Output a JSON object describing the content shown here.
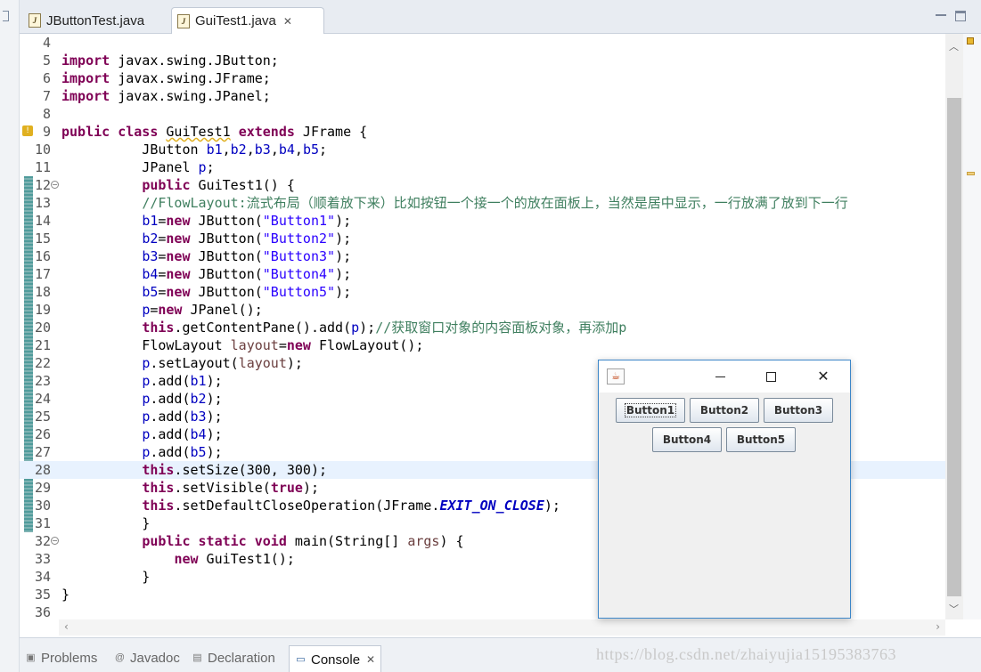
{
  "editor": {
    "tabs": [
      {
        "label": "JButtonTest.java",
        "active": false
      },
      {
        "label": "GuiTest1.java",
        "active": true
      }
    ],
    "lines": [
      {
        "num": "4",
        "html": ""
      },
      {
        "num": "5",
        "html": "<b style='color:#7f0055'>import</b> javax.swing.JButton;"
      },
      {
        "num": "6",
        "html": "<b style='color:#7f0055'>import</b> javax.swing.JFrame;"
      },
      {
        "num": "7",
        "html": "<b style='color:#7f0055'>import</b> javax.swing.JPanel;"
      },
      {
        "num": "8",
        "html": ""
      },
      {
        "num": "9",
        "html": "<b style='color:#7f0055'>public</b> <b style='color:#7f0055'>class</b> <span style='text-decoration:underline wavy #e0b020'>GuiTest1</span> <b style='color:#7f0055'>extends</b> JFrame {"
      },
      {
        "num": "10",
        "html": "          JButton <span style='color:#0000c0'>b1</span>,<span style='color:#0000c0'>b2</span>,<span style='color:#0000c0'>b3</span>,<span style='color:#0000c0'>b4</span>,<span style='color:#0000c0'>b5</span>;"
      },
      {
        "num": "11",
        "html": "          JPanel <span style='color:#0000c0'>p</span>;"
      },
      {
        "num": "12",
        "html": "          <b style='color:#7f0055'>public</b> GuiTest1() {",
        "fold": true
      },
      {
        "num": "13",
        "html": "          <span style='color:#3f7f5f'>//FlowLayout:流式布局（顺着放下来）比如按钮一个接一个的放在面板上，当然是居中显示，一行放满了放到下一行</span>"
      },
      {
        "num": "14",
        "html": "          <span style='color:#0000c0'>b1</span>=<b style='color:#7f0055'>new</b> JButton(<span style='color:#2a00ff'>\"Button1\"</span>);"
      },
      {
        "num": "15",
        "html": "          <span style='color:#0000c0'>b2</span>=<b style='color:#7f0055'>new</b> JButton(<span style='color:#2a00ff'>\"Button2\"</span>);"
      },
      {
        "num": "16",
        "html": "          <span style='color:#0000c0'>b3</span>=<b style='color:#7f0055'>new</b> JButton(<span style='color:#2a00ff'>\"Button3\"</span>);"
      },
      {
        "num": "17",
        "html": "          <span style='color:#0000c0'>b4</span>=<b style='color:#7f0055'>new</b> JButton(<span style='color:#2a00ff'>\"Button4\"</span>);"
      },
      {
        "num": "18",
        "html": "          <span style='color:#0000c0'>b5</span>=<b style='color:#7f0055'>new</b> JButton(<span style='color:#2a00ff'>\"Button5\"</span>);"
      },
      {
        "num": "19",
        "html": "          <span style='color:#0000c0'>p</span>=<b style='color:#7f0055'>new</b> JPanel();"
      },
      {
        "num": "20",
        "html": "          <b style='color:#7f0055'>this</b>.getContentPane().add(<span style='color:#0000c0'>p</span>);<span style='color:#3f7f5f'>//获取窗口对象的内容面板对象，再添加p</span>"
      },
      {
        "num": "21",
        "html": "          FlowLayout <span style='color:#6a3e3e'>layout</span>=<b style='color:#7f0055'>new</b> FlowLayout();"
      },
      {
        "num": "22",
        "html": "          <span style='color:#0000c0'>p</span>.setLayout(<span style='color:#6a3e3e'>layout</span>);"
      },
      {
        "num": "23",
        "html": "          <span style='color:#0000c0'>p</span>.add(<span style='color:#0000c0'>b1</span>);"
      },
      {
        "num": "24",
        "html": "          <span style='color:#0000c0'>p</span>.add(<span style='color:#0000c0'>b2</span>);"
      },
      {
        "num": "25",
        "html": "          <span style='color:#0000c0'>p</span>.add(<span style='color:#0000c0'>b3</span>);"
      },
      {
        "num": "26",
        "html": "          <span style='color:#0000c0'>p</span>.add(<span style='color:#0000c0'>b4</span>);"
      },
      {
        "num": "27",
        "html": "          <span style='color:#0000c0'>p</span>.add(<span style='color:#0000c0'>b5</span>);"
      },
      {
        "num": "28",
        "html": "          <b style='color:#7f0055'>this</b>.setSize(300, 300);",
        "current": true
      },
      {
        "num": "29",
        "html": "          <b style='color:#7f0055'>this</b>.setVisible(<b style='color:#7f0055'>true</b>);"
      },
      {
        "num": "30",
        "html": "          <b style='color:#7f0055'>this</b>.setDefaultCloseOperation(JFrame.<b style='color:#0000c0'><i>EXIT_ON_CLOSE</i></b>);"
      },
      {
        "num": "31",
        "html": "          }"
      },
      {
        "num": "32",
        "html": "          <b style='color:#7f0055'>public</b> <b style='color:#7f0055'>static</b> <b style='color:#7f0055'>void</b> main(String[] <span style='color:#6a3e3e'>args</span>) {",
        "fold": true
      },
      {
        "num": "33",
        "html": "              <b style='color:#7f0055'>new</b> GuiTest1();"
      },
      {
        "num": "34",
        "html": "          }"
      },
      {
        "num": "35",
        "html": "}"
      },
      {
        "num": "36",
        "html": ""
      }
    ]
  },
  "swing_frame": {
    "buttons": [
      "Button1",
      "Button2",
      "Button3",
      "Button4",
      "Button5"
    ],
    "minimize_glyph": "",
    "maximize_glyph": "",
    "close_glyph": "✕",
    "java_icon_glyph": "☕"
  },
  "bottom_tabs": [
    {
      "label": "Problems",
      "icon": "problems-icon",
      "active": false
    },
    {
      "label": "Javadoc",
      "icon": "javadoc-icon",
      "active": false
    },
    {
      "label": "Declaration",
      "icon": "declaration-icon",
      "active": false
    },
    {
      "label": "Console",
      "icon": "console-icon",
      "active": true
    }
  ],
  "watermark": "https://blog.csdn.net/zhaiyujia15195383763",
  "colors": {
    "keyword": "#7f0055",
    "field": "#0000c0",
    "string": "#2a00ff",
    "comment": "#3f7f5f",
    "local_var": "#6a3e3e",
    "current_line": "#e8f2fe",
    "frame_border": "#3c86c8"
  }
}
